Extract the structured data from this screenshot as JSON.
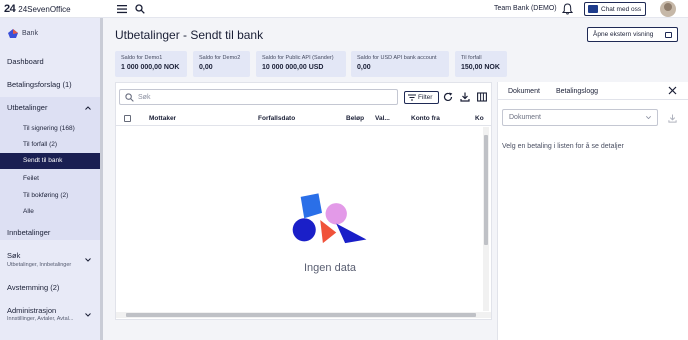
{
  "app": {
    "logo_mark": "24",
    "logo_text": "24SevenOffice",
    "team": "Team Bank (DEMO)",
    "chat_label": "Chat med oss"
  },
  "sidebar": {
    "title": "Bank",
    "items": [
      {
        "label": "Dashboard"
      },
      {
        "label": "Betalingsforslag (1)"
      },
      {
        "label": "Utbetalinger"
      },
      {
        "label": "Innbetalinger"
      },
      {
        "label": "Søk",
        "caption": "Utbetalinger, Innbetalinger"
      },
      {
        "label": "Avstemming (2)"
      },
      {
        "label": "Administrasjon",
        "caption": "Innstillinger, Avtaler, Avtal..."
      }
    ],
    "subitems": [
      {
        "label": "Til signering (168)"
      },
      {
        "label": "Til forfall (2)"
      },
      {
        "label": "Sendt til bank"
      },
      {
        "label": "Feilet"
      },
      {
        "label": "Til bokføring (2)"
      },
      {
        "label": "Alle"
      }
    ]
  },
  "page": {
    "title": "Utbetalinger - Sendt til bank",
    "open_external": "Åpne ekstern visning"
  },
  "cards": [
    {
      "label": "Saldo for Demo1",
      "value": "1 000 000,00 NOK"
    },
    {
      "label": "Saldo for Demo2",
      "value": "0,00"
    },
    {
      "label": "Saldo for Public API (Sander)",
      "value": "10 000 000,00 USD"
    },
    {
      "label": "Saldo for USD API bank account",
      "value": "0,00"
    },
    {
      "label": "Til forfall",
      "value": "150,00 NOK"
    }
  ],
  "table": {
    "search_placeholder": "Søk",
    "filter_label": "Filter",
    "columns": [
      "Mottaker",
      "Forfallsdato",
      "Beløp",
      "Val...",
      "Konto fra",
      "Ko"
    ],
    "empty_text": "Ingen data"
  },
  "detail": {
    "tabs": [
      "Dokument",
      "Betalingslogg"
    ],
    "select_value": "Dokument",
    "hint": "Velg en betaling i listen for å se detaljer"
  },
  "colors": {
    "accent": "#1a1f52",
    "illustration_blue": "#2a6fe8",
    "illustration_navy": "#1a1fc8",
    "illustration_pink": "#e39ae8",
    "illustration_orange": "#f0523a"
  }
}
